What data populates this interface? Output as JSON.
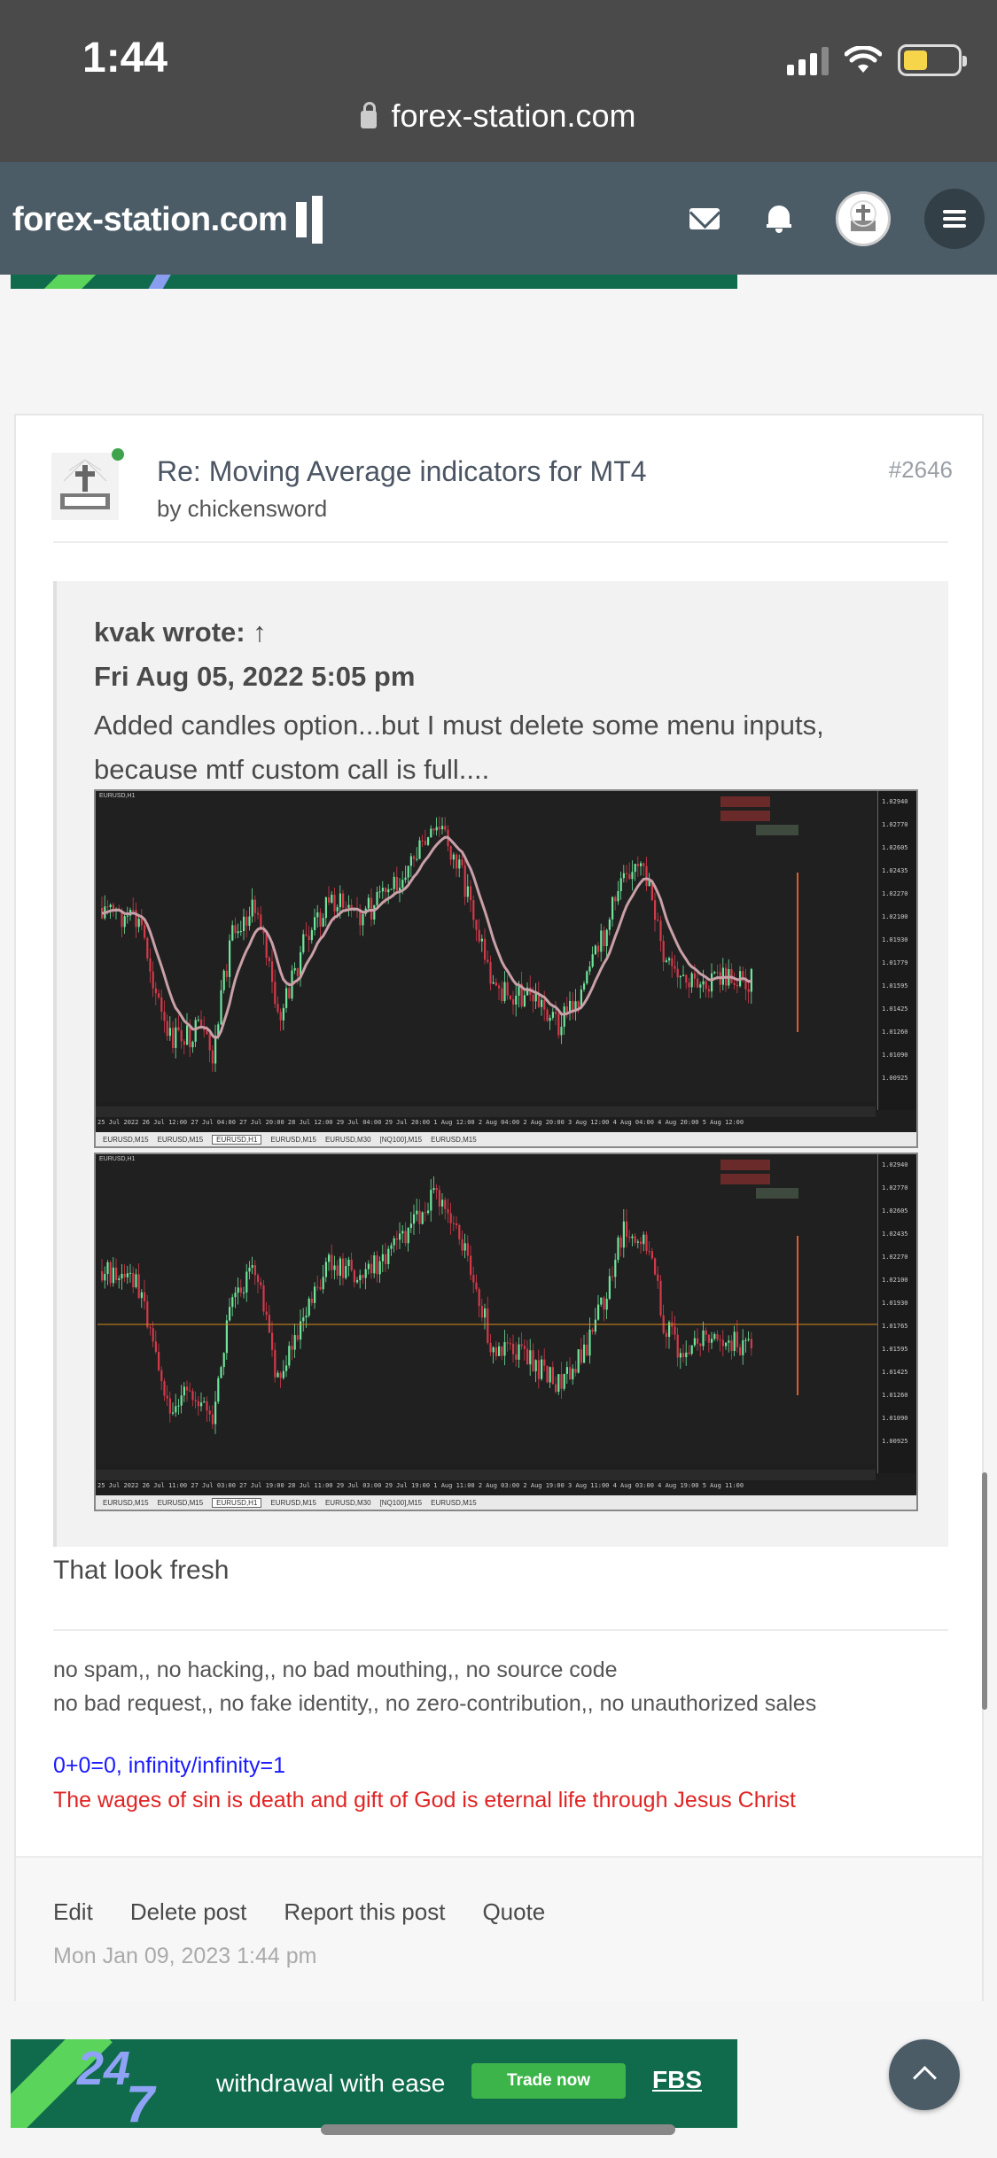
{
  "status_bar": {
    "time": "1:44",
    "url": "forex-station.com"
  },
  "header": {
    "logo_text": "forex-station.com",
    "icons": [
      "mail-icon",
      "bell-icon",
      "avatar",
      "menu-icon"
    ]
  },
  "post": {
    "title": "Re: Moving Average indicators for MT4",
    "by": "by chickensword",
    "number": "#2646",
    "quote": {
      "author": "kvak wrote: ↑",
      "date": "Fri Aug 05, 2022 5:05 pm",
      "text": "Added candles option...but I must delete some menu inputs, because mtf custom call is full...."
    },
    "chart1": {
      "symbol": "EURUSD,H1",
      "price_labels": [
        "1.02940",
        "1.02770",
        "1.02605",
        "1.02435",
        "1.02270",
        "1.02100",
        "1.01930",
        "1.01779",
        "1.01595",
        "1.01425",
        "1.01260",
        "1.01090",
        "1.00925"
      ],
      "time_labels": "25 Jul 2022   26 Jul 12:00   27 Jul 04:00   27 Jul 20:00   28 Jul 12:00   29 Jul 04:00   29 Jul 20:00   1 Aug 12:00   2 Aug 04:00   2 Aug 20:00   3 Aug 12:00   4 Aug 04:00   4 Aug 20:00   5 Aug 12:00",
      "tabs": [
        "EURUSD,M15",
        "EURUSD,M15",
        "EURUSD,H1",
        "EURUSD,M15",
        "EURUSD,M30",
        "[NQ100],M15",
        "EURUSD,M15"
      ],
      "active_tab": "EURUSD,H1"
    },
    "chart2": {
      "symbol": "EURUSD,H1",
      "price_labels": [
        "1.02940",
        "1.02770",
        "1.02605",
        "1.02435",
        "1.02270",
        "1.02100",
        "1.01930",
        "1.01765",
        "1.01595",
        "1.01425",
        "1.01260",
        "1.01090",
        "1.00925"
      ],
      "time_labels": "25 Jul 2022   26 Jul 11:00   27 Jul 03:00   27 Jul 19:00   28 Jul 11:00   29 Jul 03:00   29 Jul 19:00   1 Aug 11:00   2 Aug 03:00   2 Aug 19:00   3 Aug 11:00   4 Aug 03:00   4 Aug 19:00   5 Aug 11:00",
      "tabs": [
        "EURUSD,M15",
        "EURUSD,M15",
        "EURUSD,H1",
        "EURUSD,M15",
        "EURUSD,M30",
        "[NQ100],M15",
        "EURUSD,M15"
      ],
      "active_tab": "EURUSD,H1"
    },
    "reply": "That look fresh",
    "signature": {
      "line1": "no spam,, no hacking,, no bad mouthing,, no source code",
      "line2": "no bad request,, no fake identity,, no zero-contribution,, no unauthorized sales",
      "blue": "0+0=0, infinity/infinity=1",
      "red": "The wages of sin is death and gift of God is eternal life through Jesus Christ"
    },
    "actions": {
      "edit": "Edit",
      "delete": "Delete post",
      "report": "Report this post",
      "quote": "Quote"
    },
    "timestamp": "Mon Jan 09, 2023 1:44 pm"
  },
  "ad": {
    "big": "24",
    "small": "7",
    "text": "withdrawal with ease",
    "button": "Trade now",
    "brand": "FBS"
  },
  "colors": {
    "header_bg": "#4b5c67",
    "sig_blue": "#1a1aff",
    "sig_red": "#e02424",
    "bull": "#6ee59a",
    "bear": "#d23a4a"
  }
}
